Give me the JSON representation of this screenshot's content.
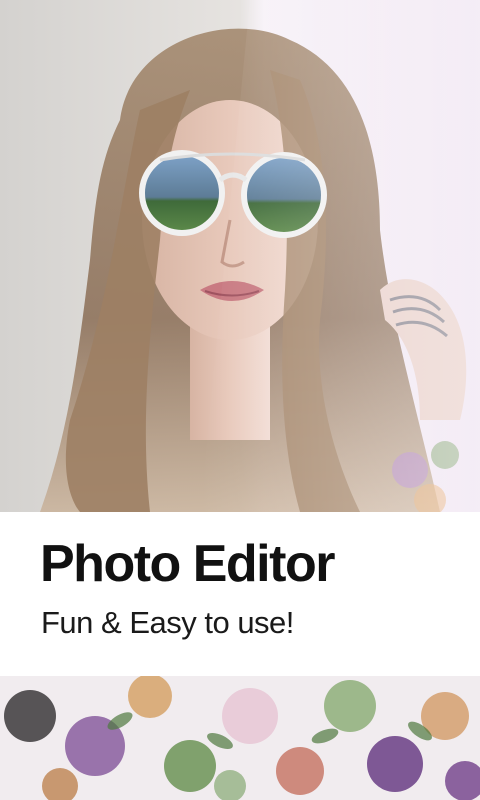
{
  "promo": {
    "title": "Photo Editor",
    "subtitle": "Fun & Easy to use!"
  },
  "images": {
    "hero": "portrait-woman-round-sunglasses",
    "strip": "floral-fabric-pattern"
  },
  "colors": {
    "title_text": "#111111",
    "background": "#ffffff"
  }
}
